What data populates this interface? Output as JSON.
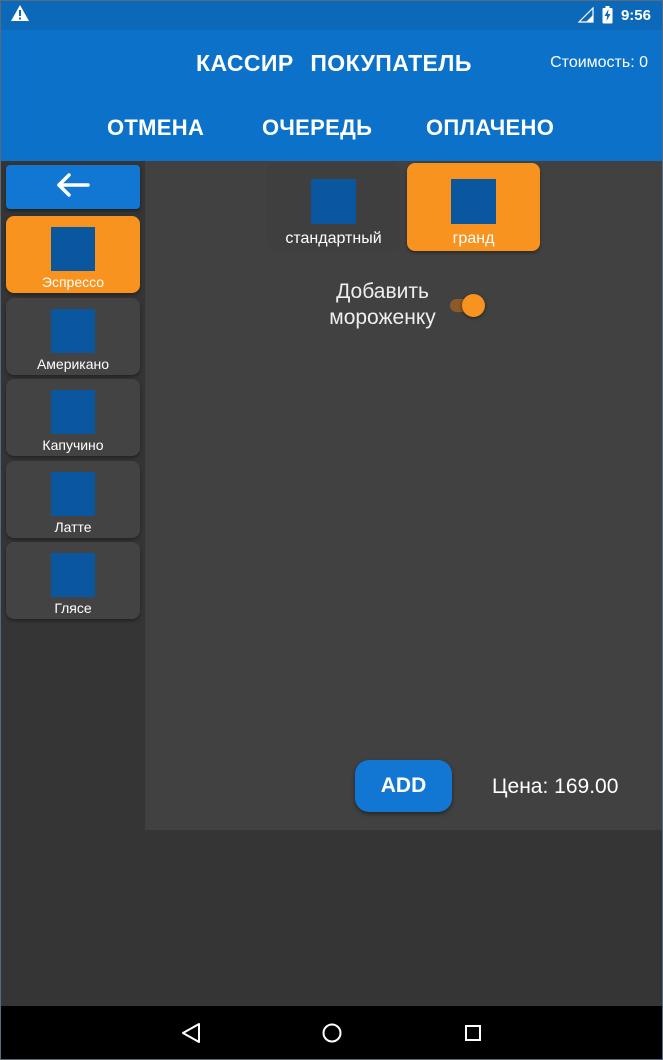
{
  "status_bar": {
    "time": "9:56",
    "icons": [
      "warning-icon",
      "signal-icon",
      "battery-charging-icon"
    ]
  },
  "app_bar": {
    "title": "КАССИР   ПОКУПАТЕЛЬ",
    "cost": "Стоимость: 0",
    "actions": {
      "cancel": "ОТМЕНА",
      "queue": "ОЧЕРЕДЬ",
      "paid": "ОПЛАЧЕНО"
    }
  },
  "sidebar": {
    "back_icon": "arrow-left-icon",
    "items": [
      {
        "label": "Эспрессо",
        "selected": true
      },
      {
        "label": "Американо",
        "selected": false
      },
      {
        "label": "Капучино",
        "selected": false
      },
      {
        "label": "Латте",
        "selected": false
      },
      {
        "label": "Глясе",
        "selected": false
      }
    ]
  },
  "main": {
    "sizes": [
      {
        "label": "стандартный",
        "selected": false
      },
      {
        "label": "гранд",
        "selected": true
      }
    ],
    "ice_cream_label": "Добавить мороженку",
    "ice_cream_enabled": true,
    "add_label": "ADD",
    "price": "Цена: 169.00"
  },
  "nav_bar": {
    "icons": [
      "back-triangle-icon",
      "home-circle-icon",
      "recents-square-icon"
    ]
  },
  "colors": {
    "primary": "#0c72c9",
    "status_bar": "#0c68b8",
    "accent": "#f7931e",
    "button_blue": "#1177d2",
    "thumbnail": "#0a579f",
    "background": "#353535",
    "panel": "#414141"
  }
}
